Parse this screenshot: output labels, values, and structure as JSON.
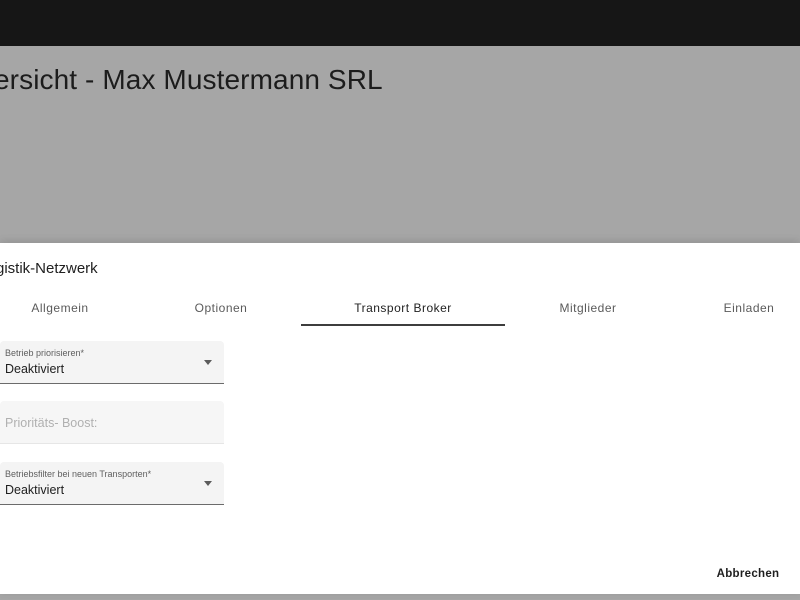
{
  "page": {
    "title": "ersicht - Max Mustermann SRL"
  },
  "dialog": {
    "title": "gistik-Netzwerk",
    "tabs": [
      {
        "label": "Allgemein",
        "active": false
      },
      {
        "label": "Optionen",
        "active": false
      },
      {
        "label": "Transport Broker",
        "active": true
      },
      {
        "label": "Mitglieder",
        "active": false
      },
      {
        "label": "Einladen",
        "active": false
      }
    ],
    "fields": {
      "prioritize": {
        "label": "Betrieb priorisieren*",
        "value": "Deaktiviert",
        "icon": "chevron-down-icon"
      },
      "priority_boost": {
        "placeholder": "Prioritäts- Boost:",
        "disabled": true
      },
      "operation_filter": {
        "label": "Betriebsfilter bei neuen Transporten*",
        "value": "Deaktiviert",
        "icon": "chevron-down-icon"
      }
    },
    "cancel_label": "Abbrechen"
  },
  "colors": {
    "topbar": "#161616",
    "backdrop": "#a6a6a6",
    "dialog": "#ffffff",
    "field_bg": "#f4f4f4",
    "tab_indicator": "#3d3d3d"
  }
}
